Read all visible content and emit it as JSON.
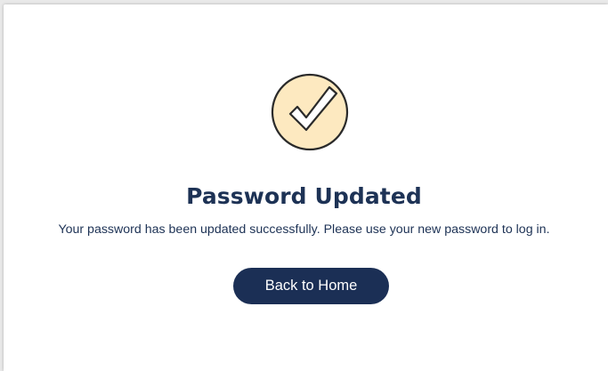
{
  "dialog": {
    "title": "Password Updated",
    "message": "Your password has been updated successfully. Please use your new password to log in.",
    "button_label": "Back to Home",
    "icon": "check-circle-icon"
  },
  "colors": {
    "heading": "#1d3255",
    "button_bg": "#1b2f55",
    "button_text": "#ffffff",
    "icon_fill": "#fde9c0",
    "icon_stroke": "#2a2a2a"
  }
}
